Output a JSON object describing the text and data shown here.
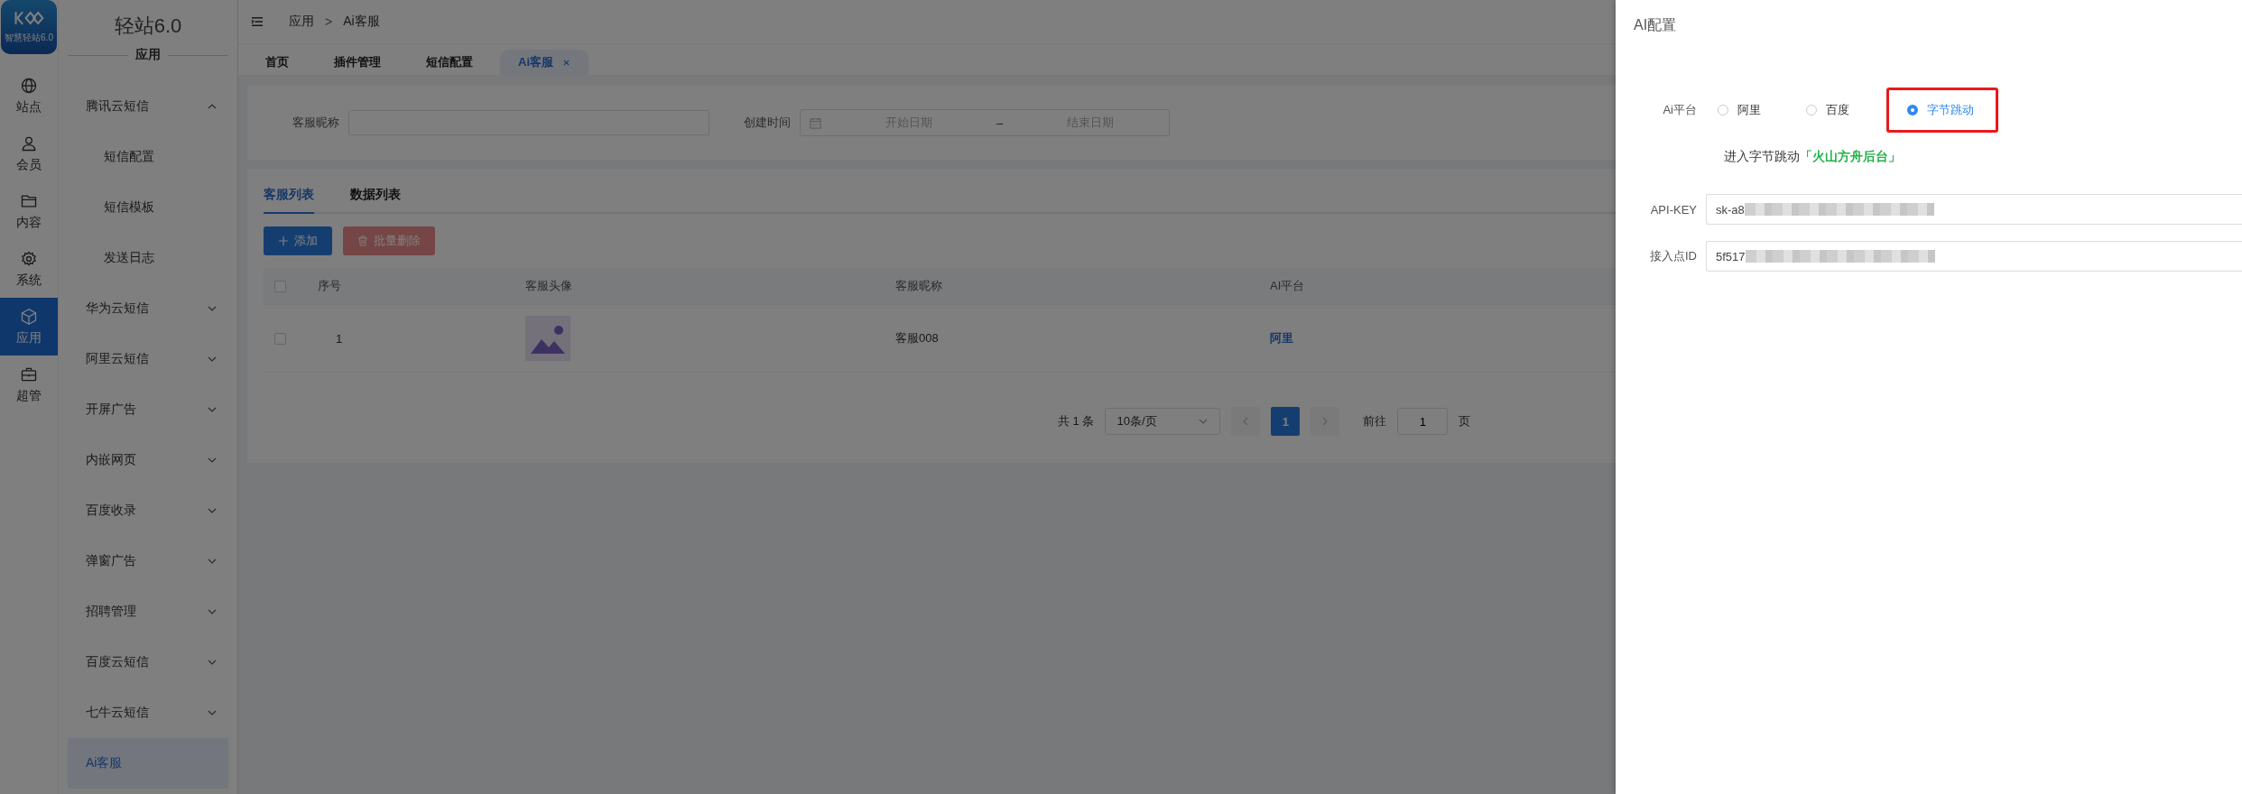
{
  "app_rail": {
    "logo_text": "智慧轻站6.0",
    "items": [
      {
        "label": "站点",
        "selected": false
      },
      {
        "label": "会员",
        "selected": false
      },
      {
        "label": "内容",
        "selected": false
      },
      {
        "label": "系统",
        "selected": false
      },
      {
        "label": "应用",
        "selected": true
      },
      {
        "label": "超管",
        "selected": false
      }
    ]
  },
  "sidebar": {
    "title": "轻站6.0",
    "section": "应用",
    "items": [
      {
        "label": "腾讯云短信",
        "kind": "group",
        "expanded": true,
        "selected": false,
        "children": [
          {
            "label": "短信配置",
            "selected": false
          },
          {
            "label": "短信模板",
            "selected": false
          },
          {
            "label": "发送日志",
            "selected": false
          }
        ]
      },
      {
        "label": "华为云短信",
        "kind": "group",
        "expanded": false,
        "selected": false
      },
      {
        "label": "阿里云短信",
        "kind": "group",
        "expanded": false,
        "selected": false
      },
      {
        "label": "开屏广告",
        "kind": "group",
        "expanded": false,
        "selected": false
      },
      {
        "label": "内嵌网页",
        "kind": "group",
        "expanded": false,
        "selected": false
      },
      {
        "label": "百度收录",
        "kind": "group",
        "expanded": false,
        "selected": false
      },
      {
        "label": "弹窗广告",
        "kind": "group",
        "expanded": false,
        "selected": false
      },
      {
        "label": "招聘管理",
        "kind": "group",
        "expanded": false,
        "selected": false
      },
      {
        "label": "百度云短信",
        "kind": "group",
        "expanded": false,
        "selected": false
      },
      {
        "label": "七牛云短信",
        "kind": "group",
        "expanded": false,
        "selected": false
      },
      {
        "label": "Ai客服",
        "kind": "link",
        "selected": true
      }
    ]
  },
  "breadcrumb": {
    "items": [
      "应用",
      "Ai客服"
    ],
    "separator": ">"
  },
  "page_tabs": [
    {
      "label": "首页",
      "selected": false,
      "closable": false
    },
    {
      "label": "插件管理",
      "selected": false,
      "closable": false
    },
    {
      "label": "短信配置",
      "selected": false,
      "closable": false
    },
    {
      "label": "Ai客服",
      "selected": true,
      "closable": true
    }
  ],
  "filters": {
    "nickname": {
      "label": "客服昵称"
    },
    "created": {
      "label": "创建时间",
      "start_placeholder": "开始日期",
      "separator": "–",
      "end_placeholder": "结束日期"
    }
  },
  "list_tabs": [
    {
      "label": "客服列表",
      "selected": true
    },
    {
      "label": "数据列表",
      "selected": false
    }
  ],
  "buttons": [
    {
      "label": "添加",
      "kind": "add",
      "disabled": false
    },
    {
      "label": "批量删除",
      "kind": "delete",
      "disabled": true
    }
  ],
  "table": {
    "all_checked": false,
    "columns": [
      "序号",
      "客服头像",
      "客服昵称",
      "AI平台"
    ],
    "rows": [
      {
        "checked": false,
        "index": "1",
        "nickname": "客服008",
        "platform": "阿里"
      }
    ]
  },
  "pagination": {
    "total": "共 1 条",
    "page_size": "10条/页",
    "pages": [
      {
        "label": "1",
        "selected": true
      }
    ],
    "goto_label": "前往",
    "goto_value": "1",
    "goto_suffix": "页"
  },
  "drawer": {
    "title": "AI配置",
    "platform": {
      "label": "Ai平台",
      "options": [
        {
          "label": "阿里",
          "selected": false
        },
        {
          "label": "百度",
          "selected": false
        },
        {
          "label": "字节跳动",
          "selected": true
        }
      ]
    },
    "hint": {
      "text": "进入字节跳动",
      "link": "「火山方舟后台」"
    },
    "fields": [
      {
        "label": "API-KEY",
        "value": "sk-a8"
      },
      {
        "label": "接入点ID",
        "value": "5f517"
      }
    ]
  }
}
